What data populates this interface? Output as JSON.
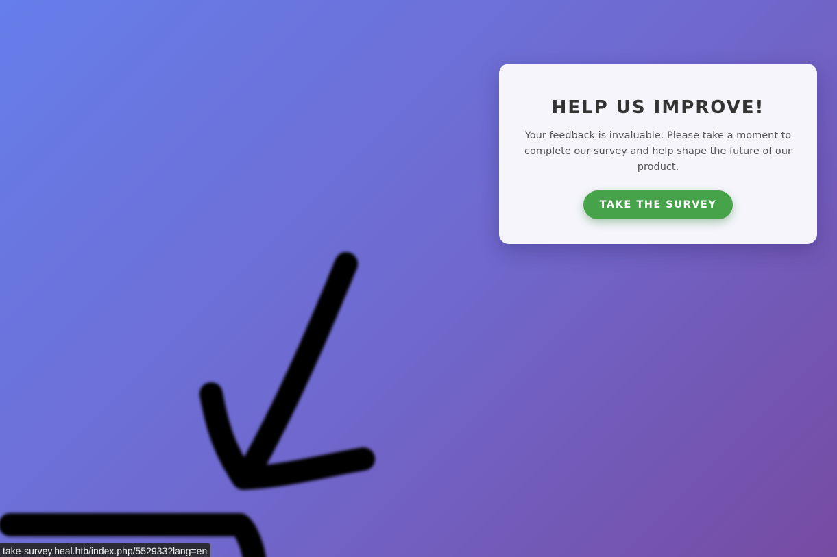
{
  "card": {
    "title": "HELP US IMPROVE!",
    "text": "Your feedback is invaluable. Please take a moment to complete our survey and help shape the future of our product.",
    "button_label": "TAKE THE SURVEY"
  },
  "status_bar": {
    "url": "take-survey.heal.htb/index.php/552933?lang=en"
  },
  "colors": {
    "gradient_start": "#667eea",
    "gradient_end": "#764ba2",
    "button": "#46a34a",
    "title": "#333333"
  }
}
